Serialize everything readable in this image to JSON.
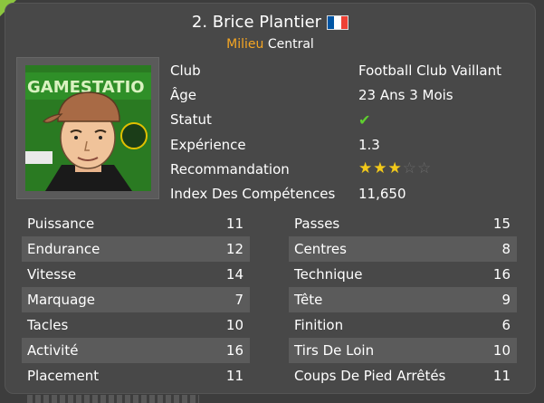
{
  "player": {
    "title": "2. Brice Plantier",
    "position_primary": "Milieu",
    "position_secondary": "Central",
    "flag_colors": [
      "#0055a4",
      "#ffffff",
      "#ef4135"
    ]
  },
  "photo": {
    "banner_text": "GAMESTATIO",
    "icon": "player-avatar"
  },
  "info": [
    {
      "label": "Club",
      "value": "Football Club Vaillant"
    },
    {
      "label": "Âge",
      "value": "23 Ans 3 Mois"
    },
    {
      "label": "Statut",
      "value": "✔"
    },
    {
      "label": "Expérience",
      "value": "1.3"
    },
    {
      "label": "Recommandation",
      "stars_on": 3,
      "stars_total": 5
    },
    {
      "label": "Index Des Compétences",
      "value": "11,650"
    }
  ],
  "stats_left": [
    {
      "label": "Puissance",
      "value": "11"
    },
    {
      "label": "Endurance",
      "value": "12"
    },
    {
      "label": "Vitesse",
      "value": "14"
    },
    {
      "label": "Marquage",
      "value": "7"
    },
    {
      "label": "Tacles",
      "value": "10"
    },
    {
      "label": "Activité",
      "value": "16"
    },
    {
      "label": "Placement",
      "value": "11"
    }
  ],
  "stats_right": [
    {
      "label": "Passes",
      "value": "15"
    },
    {
      "label": "Centres",
      "value": "8"
    },
    {
      "label": "Technique",
      "value": "16"
    },
    {
      "label": "Tête",
      "value": "9"
    },
    {
      "label": "Finition",
      "value": "6"
    },
    {
      "label": "Tirs De Loin",
      "value": "10"
    },
    {
      "label": "Coups De Pied Arrêtés",
      "value": "11"
    }
  ],
  "colors": {
    "accent": "#f5a623",
    "check": "#5fcf2f",
    "star_on": "#f2c91a"
  }
}
